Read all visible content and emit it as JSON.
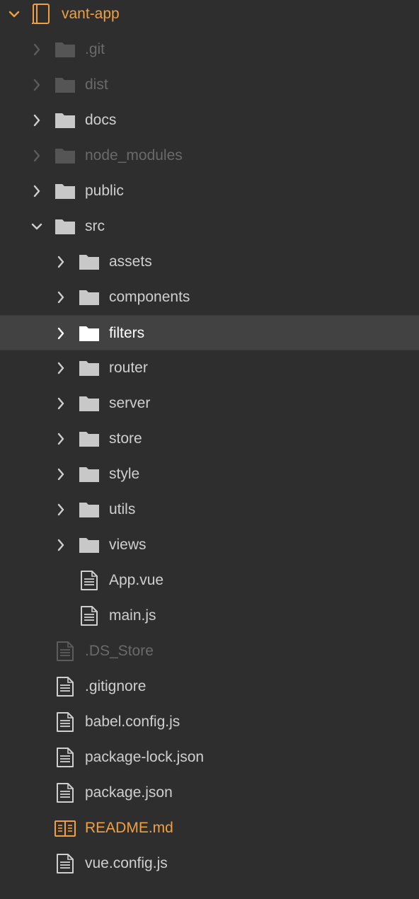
{
  "tree": {
    "root": {
      "label": "vant-app",
      "icon": "project-book-icon",
      "expanded": true,
      "color": "#f0a040"
    },
    "items": [
      {
        "label": ".git",
        "type": "folder",
        "depth": 1,
        "expanded": false,
        "state": "dim"
      },
      {
        "label": "dist",
        "type": "folder",
        "depth": 1,
        "expanded": false,
        "state": "dim"
      },
      {
        "label": "docs",
        "type": "folder",
        "depth": 1,
        "expanded": false,
        "state": "normal"
      },
      {
        "label": "node_modules",
        "type": "folder",
        "depth": 1,
        "expanded": false,
        "state": "dim"
      },
      {
        "label": "public",
        "type": "folder",
        "depth": 1,
        "expanded": false,
        "state": "normal"
      },
      {
        "label": "src",
        "type": "folder",
        "depth": 1,
        "expanded": true,
        "state": "normal"
      },
      {
        "label": "assets",
        "type": "folder",
        "depth": 2,
        "expanded": false,
        "state": "normal"
      },
      {
        "label": "components",
        "type": "folder",
        "depth": 2,
        "expanded": false,
        "state": "normal"
      },
      {
        "label": "filters",
        "type": "folder",
        "depth": 2,
        "expanded": false,
        "state": "selected"
      },
      {
        "label": "router",
        "type": "folder",
        "depth": 2,
        "expanded": false,
        "state": "normal"
      },
      {
        "label": "server",
        "type": "folder",
        "depth": 2,
        "expanded": false,
        "state": "normal"
      },
      {
        "label": "store",
        "type": "folder",
        "depth": 2,
        "expanded": false,
        "state": "normal"
      },
      {
        "label": "style",
        "type": "folder",
        "depth": 2,
        "expanded": false,
        "state": "normal"
      },
      {
        "label": "utils",
        "type": "folder",
        "depth": 2,
        "expanded": false,
        "state": "normal"
      },
      {
        "label": "views",
        "type": "folder",
        "depth": 2,
        "expanded": false,
        "state": "normal"
      },
      {
        "label": "App.vue",
        "type": "file",
        "depth": 2,
        "state": "normal"
      },
      {
        "label": "main.js",
        "type": "file",
        "depth": 2,
        "state": "normal"
      },
      {
        "label": ".DS_Store",
        "type": "file",
        "depth": 1,
        "state": "dim"
      },
      {
        "label": ".gitignore",
        "type": "file",
        "depth": 1,
        "state": "normal"
      },
      {
        "label": "babel.config.js",
        "type": "file",
        "depth": 1,
        "state": "normal"
      },
      {
        "label": "package-lock.json",
        "type": "file",
        "depth": 1,
        "state": "normal"
      },
      {
        "label": "package.json",
        "type": "file",
        "depth": 1,
        "state": "normal"
      },
      {
        "label": "README.md",
        "type": "readme",
        "depth": 1,
        "state": "accent"
      },
      {
        "label": "vue.config.js",
        "type": "file",
        "depth": 1,
        "state": "normal"
      }
    ],
    "colors": {
      "background": "#2e2e2e",
      "selected_background": "#424242",
      "text": "#cfcfcf",
      "text_dim": "#6a6a6a",
      "accent": "#f0a040",
      "folder": "#c8c8c8",
      "folder_dim": "#555555",
      "folder_selected": "#ffffff"
    }
  }
}
